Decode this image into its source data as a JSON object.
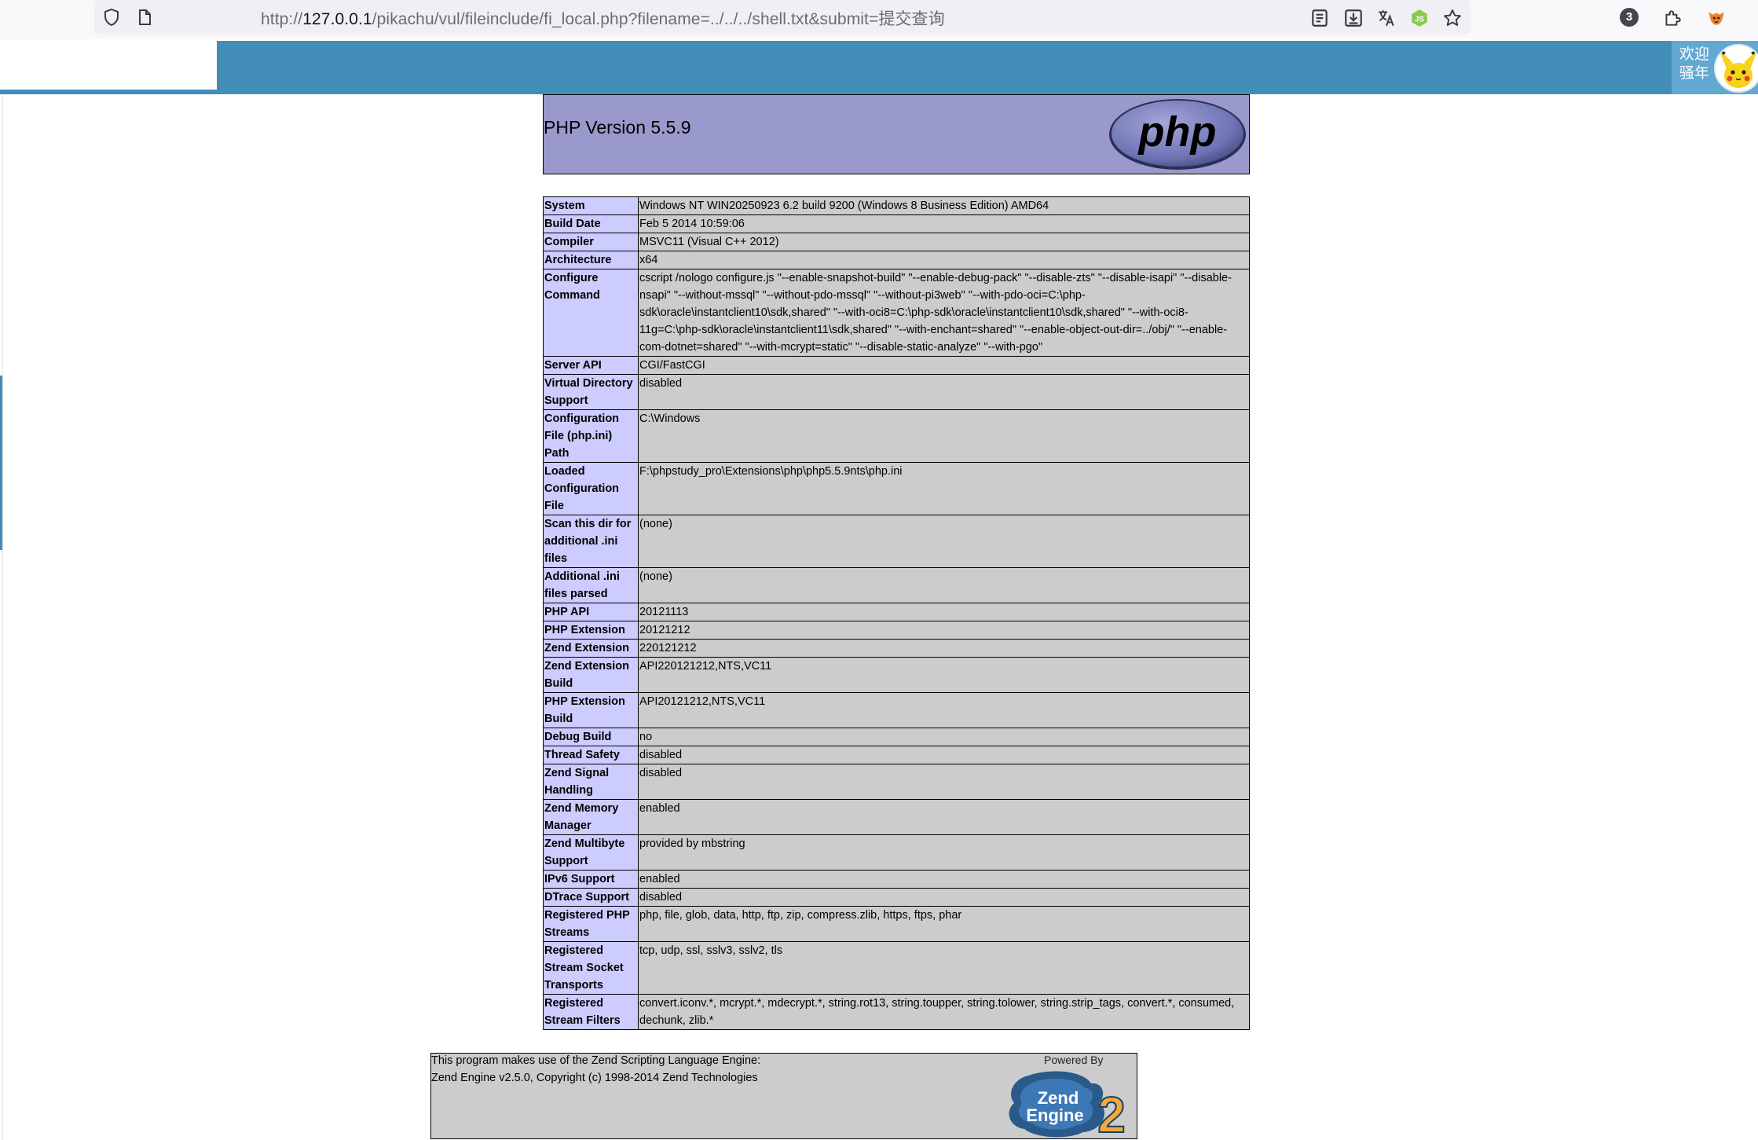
{
  "browser": {
    "url_prefix": "http://",
    "url_host": "127.0.0.1",
    "url_path": "/pikachu/vul/fileinclude/fi_local.php?filename=../../../shell.txt&submit=提交查询",
    "tab_count": "3"
  },
  "site": {
    "welcome": "欢迎骚年"
  },
  "phpinfo": {
    "title": "PHP Version 5.5.9",
    "rows": [
      {
        "label": "System",
        "value": "Windows NT WIN20250923 6.2 build 9200 (Windows 8 Business Edition) AMD64"
      },
      {
        "label": "Build Date",
        "value": "Feb 5 2014 10:59:06"
      },
      {
        "label": "Compiler",
        "value": "MSVC11 (Visual C++ 2012)"
      },
      {
        "label": "Architecture",
        "value": "x64"
      },
      {
        "label": "Configure Command",
        "value": "cscript /nologo configure.js \"--enable-snapshot-build\" \"--enable-debug-pack\" \"--disable-zts\" \"--disable-isapi\" \"--disable-nsapi\" \"--without-mssql\" \"--without-pdo-mssql\" \"--without-pi3web\" \"--with-pdo-oci=C:\\php-sdk\\oracle\\instantclient10\\sdk,shared\" \"--with-oci8=C:\\php-sdk\\oracle\\instantclient10\\sdk,shared\" \"--with-oci8-11g=C:\\php-sdk\\oracle\\instantclient11\\sdk,shared\" \"--with-enchant=shared\" \"--enable-object-out-dir=../obj/\" \"--enable-com-dotnet=shared\" \"--with-mcrypt=static\" \"--disable-static-analyze\" \"--with-pgo\""
      },
      {
        "label": "Server API",
        "value": "CGI/FastCGI"
      },
      {
        "label": "Virtual Directory Support",
        "value": "disabled"
      },
      {
        "label": "Configuration File (php.ini) Path",
        "value": "C:\\Windows"
      },
      {
        "label": "Loaded Configuration File",
        "value": "F:\\phpstudy_pro\\Extensions\\php\\php5.5.9nts\\php.ini"
      },
      {
        "label": "Scan this dir for additional .ini files",
        "value": "(none)"
      },
      {
        "label": "Additional .ini files parsed",
        "value": "(none)"
      },
      {
        "label": "PHP API",
        "value": "20121113"
      },
      {
        "label": "PHP Extension",
        "value": "20121212"
      },
      {
        "label": "Zend Extension",
        "value": "220121212"
      },
      {
        "label": "Zend Extension Build",
        "value": "API220121212,NTS,VC11"
      },
      {
        "label": "PHP Extension Build",
        "value": "API20121212,NTS,VC11"
      },
      {
        "label": "Debug Build",
        "value": "no"
      },
      {
        "label": "Thread Safety",
        "value": "disabled"
      },
      {
        "label": "Zend Signal Handling",
        "value": "disabled"
      },
      {
        "label": "Zend Memory Manager",
        "value": "enabled"
      },
      {
        "label": "Zend Multibyte Support",
        "value": "provided by mbstring"
      },
      {
        "label": "IPv6 Support",
        "value": "enabled"
      },
      {
        "label": "DTrace Support",
        "value": "disabled"
      },
      {
        "label": "Registered PHP Streams",
        "value": "php, file, glob, data, http, ftp, zip, compress.zlib, https, ftps, phar"
      },
      {
        "label": "Registered Stream Socket Transports",
        "value": "tcp, udp, ssl, sslv3, sslv2, tls"
      },
      {
        "label": "Registered Stream Filters",
        "value": "convert.iconv.*, mcrypt.*, mdecrypt.*, string.rot13, string.toupper, string.tolower, string.strip_tags, convert.*, consumed, dechunk, zlib.*"
      }
    ],
    "zend": {
      "line1": "This program makes use of the Zend Scripting Language Engine:",
      "line2": "Zend Engine v2.5.0, Copyright (c) 1998-2014 Zend Technologies",
      "powered_by": "Powered By"
    }
  },
  "colors": {
    "header_blue": "#438eb9",
    "php_header": "#9999cc",
    "label_cell": "#ccccff",
    "value_cell": "#cccccc"
  }
}
